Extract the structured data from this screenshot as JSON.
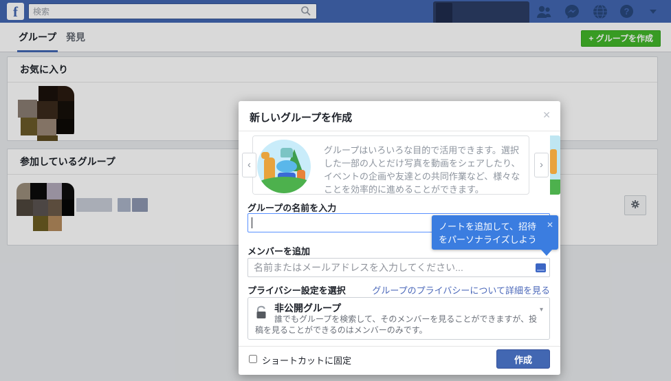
{
  "nav": {
    "logo_letter": "f",
    "search_placeholder": "検索"
  },
  "tabs": {
    "groups": "グループ",
    "discover": "発見"
  },
  "actions": {
    "create_group": "+ グループを作成"
  },
  "sections": {
    "favorites_title": "お気に入り",
    "joined_title": "参加しているグループ"
  },
  "modal": {
    "title": "新しいグループを作成",
    "carousel": {
      "description": "グループはいろいろな目的で活用できます。選択した一部の人とだけ写真を動画をシェアしたり、イベントの企画や友達との共同作業など、様々なことを効率的に進めることができます。"
    },
    "group_name_label": "グループの名前を入力",
    "members_label": "メンバーを追加",
    "members_placeholder": "名前またはメールアドレスを入力してください...",
    "privacy_label": "プライバシー設定を選択",
    "privacy_link": "グループのプライバシーについて詳細を見る",
    "privacy_selected": {
      "title": "非公開グループ",
      "description": "誰でもグループを検索して、そのメンバーを見ることができますが、投稿を見ることができるのはメンバーのみです。"
    },
    "pin_shortcut_label": "ショートカットに固定",
    "create_button": "作成"
  },
  "tooltip": {
    "text": "ノートを追加して、招待をパーソナライズしよう"
  },
  "icons": {
    "close": "✕",
    "prev": "‹",
    "next": "›",
    "help": "?",
    "dropdown_caret": "▾"
  },
  "colors": {
    "nav_blue": "#4267b2",
    "accent_green": "#42b72a",
    "tooltip_blue": "#3b7de0",
    "button_blue": "#4267b2",
    "focus_border": "#5890ff"
  }
}
